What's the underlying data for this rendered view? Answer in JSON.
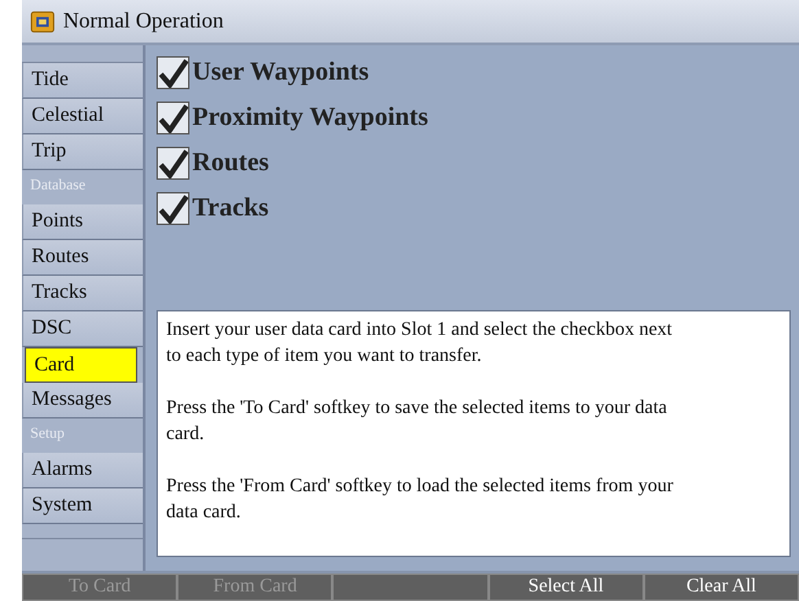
{
  "window": {
    "title": "Normal Operation"
  },
  "sidebar": {
    "items": [
      {
        "kind": "tab",
        "label": "Tide",
        "selected": false
      },
      {
        "kind": "tab",
        "label": "Celestial",
        "selected": false
      },
      {
        "kind": "tab",
        "label": "Trip",
        "selected": false
      },
      {
        "kind": "header",
        "label": "Database"
      },
      {
        "kind": "tab",
        "label": "Points",
        "selected": false
      },
      {
        "kind": "tab",
        "label": "Routes",
        "selected": false
      },
      {
        "kind": "tab",
        "label": "Tracks",
        "selected": false
      },
      {
        "kind": "tab",
        "label": "DSC",
        "selected": false
      },
      {
        "kind": "tab",
        "label": "Card",
        "selected": true
      },
      {
        "kind": "tab",
        "label": "Messages",
        "selected": false
      },
      {
        "kind": "header",
        "label": "Setup"
      },
      {
        "kind": "tab",
        "label": "Alarms",
        "selected": false
      },
      {
        "kind": "tab",
        "label": "System",
        "selected": false
      }
    ]
  },
  "items": [
    {
      "label": "User Waypoints",
      "checked": true
    },
    {
      "label": "Proximity Waypoints",
      "checked": true
    },
    {
      "label": "Routes",
      "checked": true
    },
    {
      "label": "Tracks",
      "checked": true
    }
  ],
  "instructions": [
    "Insert your user data card into Slot 1 and select the checkbox next to each type of item you want to transfer.",
    "Press the 'To Card' softkey to save the selected items to your data card.",
    "Press the 'From Card' softkey to load the selected items from your data card."
  ],
  "softkeys": [
    {
      "kind": "key",
      "label": "To Card",
      "disabled": true
    },
    {
      "kind": "key",
      "label": "From Card",
      "disabled": true
    },
    {
      "kind": "blank"
    },
    {
      "kind": "key",
      "label": "Select All",
      "disabled": false
    },
    {
      "kind": "key",
      "label": "Clear All",
      "disabled": false
    }
  ]
}
